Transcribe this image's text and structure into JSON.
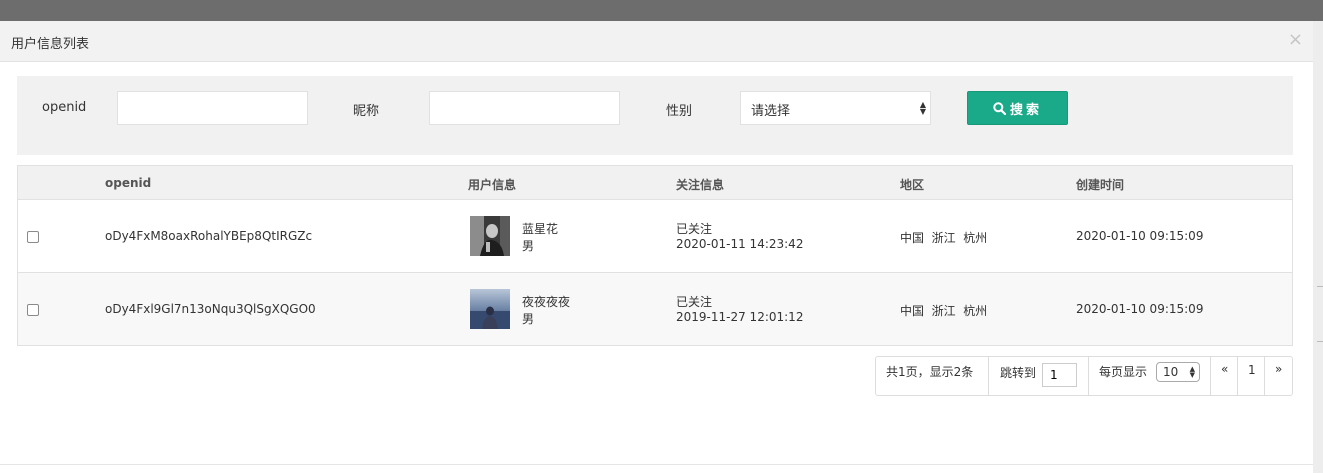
{
  "modal": {
    "title": "用户信息列表",
    "close_glyph": "×"
  },
  "search": {
    "openid_label": "openid",
    "openid_value": "",
    "nickname_label": "昵称",
    "nickname_value": "",
    "gender_label": "性别",
    "gender_selected": "请选择",
    "button_label": "搜索",
    "button_icon": "search-icon"
  },
  "table": {
    "columns": [
      "openid",
      "用户信息",
      "关注信息",
      "地区",
      "创建时间"
    ],
    "rows": [
      {
        "checked": false,
        "openid": "oDy4FxM8oaxRohalYBEp8QtIRGZc",
        "nickname": "蓝星花",
        "gender": "男",
        "follow_status": "已关注",
        "follow_time": "2020-01-11 14:23:42",
        "region": "中国  浙江  杭州",
        "created": "2020-01-10 09:15:09"
      },
      {
        "checked": false,
        "openid": "oDy4Fxl9Gl7n13oNqu3QlSgXQGO0",
        "nickname": "夜夜夜夜",
        "gender": "男",
        "follow_status": "已关注",
        "follow_time": "2019-11-27 12:01:12",
        "region": "中国  浙江  杭州",
        "created": "2020-01-10 09:15:09"
      }
    ]
  },
  "pagination": {
    "summary": "共1页，显示2条",
    "jump_label": "跳转到",
    "jump_value": "1",
    "per_page_label": "每页显示",
    "per_page_value": "10",
    "prev": "«",
    "current_page": "1",
    "next": "»"
  },
  "colors": {
    "primary_button": "#1aaa8a",
    "header_bg": "#f2f2f2",
    "panel_bg": "#f1f1f1"
  }
}
